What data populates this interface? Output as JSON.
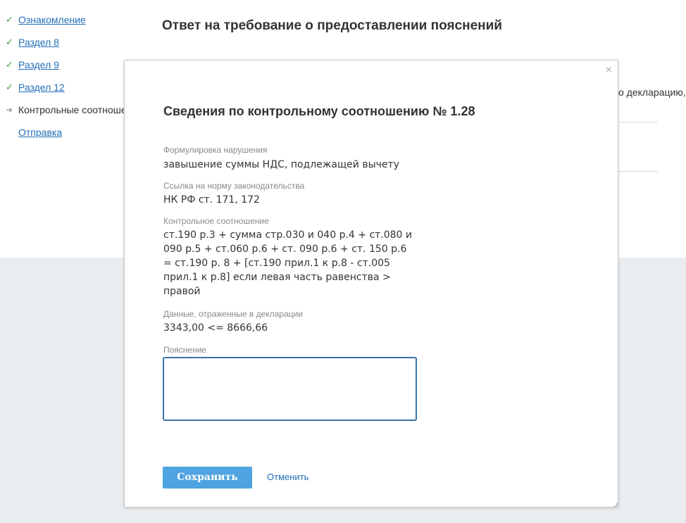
{
  "sidebar": {
    "items": [
      {
        "label": "Ознакомление",
        "state": "done"
      },
      {
        "label": "Раздел 8",
        "state": "done"
      },
      {
        "label": "Раздел 9",
        "state": "done"
      },
      {
        "label": "Раздел 12",
        "state": "done"
      },
      {
        "label": "Контрольные соотношен",
        "state": "current"
      },
      {
        "label": "Отправка",
        "state": "pending"
      }
    ],
    "icons": {
      "done": "check-icon",
      "current": "arrow-right-icon"
    }
  },
  "main": {
    "title": "Ответ на требование о предоставлении пояснений",
    "background_snippet": "о декларацию, с"
  },
  "modal": {
    "close_glyph": "×",
    "title": "Сведения по контрольному соотношению № 1.28",
    "violation_label": "Формулировка нарушения",
    "violation_value": "завышение суммы НДС, подлежащей вычету",
    "law_label": "Ссылка на норму законодательства",
    "law_value": "НК РФ ст. 171, 172",
    "control_label": "Контрольное соотношение",
    "control_value": "ст.190 р.3 + сумма стр.030 и 040 р.4 + ст.080 и 090 р.5 + ст.060 р.6 + ст. 090 р.6 + ст. 150 р.6 = ст.190 р. 8 + [ст.190 прил.1 к р.8 - ст.005 прил.1 к р.8] если левая часть равенства > правой",
    "data_label": "Данные, отраженные в декларации",
    "data_value": "3343,00 <= 8666,66",
    "explanation_label": "Пояснение",
    "explanation_value": "",
    "save_label": "Сохранить",
    "cancel_label": "Отменить"
  },
  "colors": {
    "accent": "#4fa3e0",
    "link": "#1f6eb6",
    "check": "#3aa03a",
    "page_bottom": "#e9edf0"
  }
}
